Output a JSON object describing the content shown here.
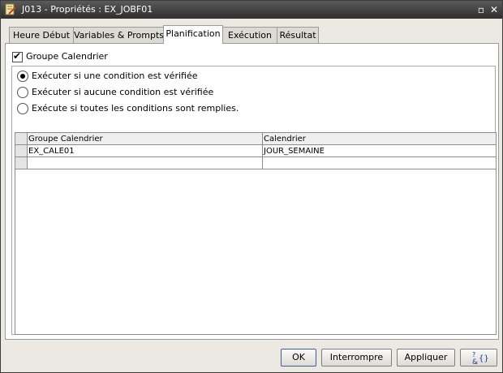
{
  "window": {
    "title": "J013 - Propriétés : EX_JOBF01",
    "minimize_glyph": "▫",
    "close_glyph": "✕"
  },
  "tabs": [
    {
      "label": "Heure Début",
      "active": false
    },
    {
      "label": "Variables & Prompts",
      "active": false
    },
    {
      "label": "Planification",
      "active": true
    },
    {
      "label": "Exécution",
      "active": false
    },
    {
      "label": "Résultat",
      "active": false
    }
  ],
  "planification": {
    "groupe_calendrier_checkbox": {
      "label": "Groupe Calendrier",
      "checked": true
    },
    "radios": [
      {
        "label": "Exécuter si une condition est vérifiée",
        "selected": true
      },
      {
        "label": "Exécuter si aucune condition est vérifiée",
        "selected": false
      },
      {
        "label": "Exécute si toutes les conditions sont remplies.",
        "selected": false
      }
    ],
    "table": {
      "columns": [
        "Groupe Calendrier",
        "Calendrier"
      ],
      "rows": [
        [
          "EX_CALE01",
          "JOUR_SEMAINE"
        ],
        [
          "",
          ""
        ]
      ]
    }
  },
  "buttons": {
    "ok": "OK",
    "cancel": "Interrompre",
    "apply": "Appliquer",
    "help_icon": "help-variables-icon"
  },
  "colors": {
    "titlebar": "#3a3a3a",
    "dialog_bg": "#ece9e2",
    "primary_border": "#3d5f8e"
  }
}
